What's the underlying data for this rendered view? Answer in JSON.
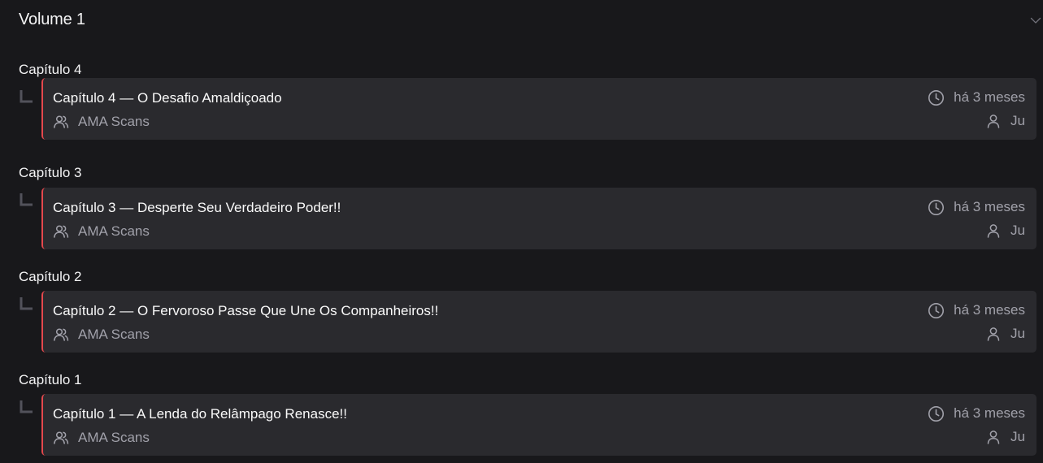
{
  "volume": {
    "title": "Volume 1",
    "chevron_icon": "chevron-down-icon"
  },
  "chapters": [
    {
      "label": "Capítulo 4",
      "title": "Capítulo 4 — O Desafio Amaldiçoado",
      "scan_group": "AMA Scans",
      "time_ago": "há 3 meses",
      "uploader": "Ju"
    },
    {
      "label": "Capítulo 3",
      "title": "Capítulo 3 — Desperte Seu Verdadeiro Poder!!",
      "scan_group": "AMA Scans",
      "time_ago": "há 3 meses",
      "uploader": "Ju"
    },
    {
      "label": "Capítulo 2",
      "title": "Capítulo 2 — O Fervoroso Passe Que Une Os Companheiros!!",
      "scan_group": "AMA Scans",
      "time_ago": "há 3 meses",
      "uploader": "Ju"
    },
    {
      "label": "Capítulo 1",
      "title": "Capítulo 1 — A Lenda do Relâmpago Renasce!!",
      "scan_group": "AMA Scans",
      "time_ago": "há 3 meses",
      "uploader": "Ju"
    }
  ],
  "colors": {
    "background": "#18181b",
    "card": "#2a2a2e",
    "accent": "#e5484d",
    "muted_text": "#a1a1aa"
  }
}
